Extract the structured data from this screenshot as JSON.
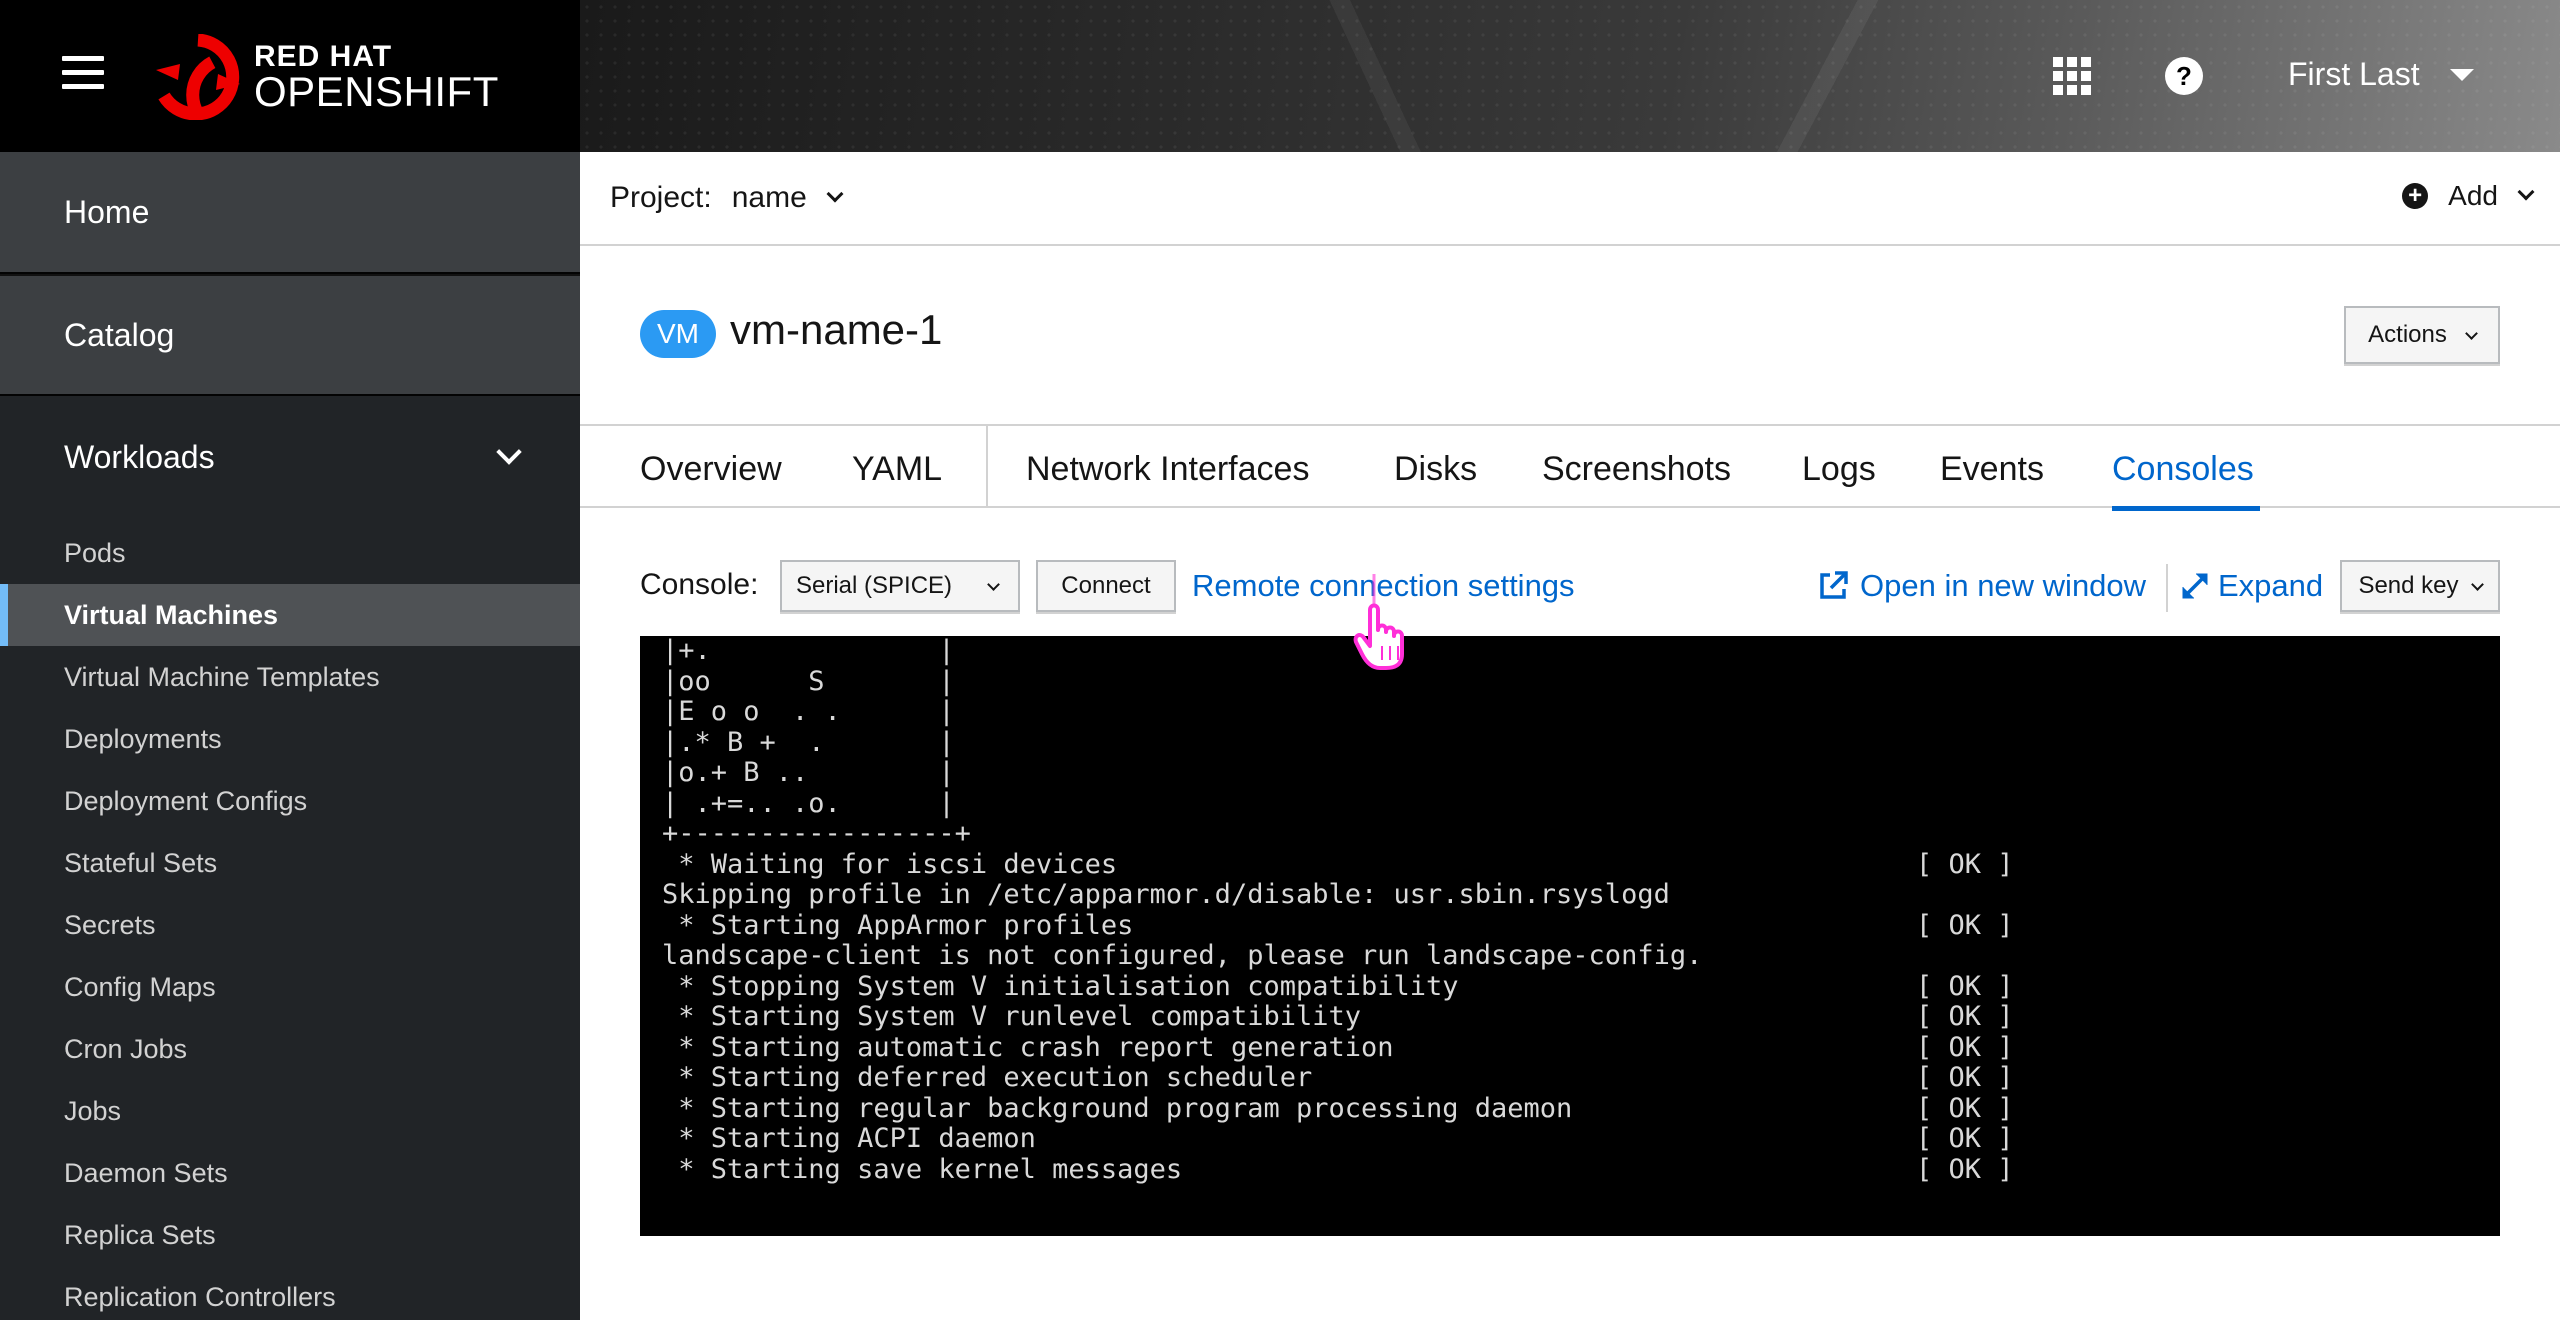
{
  "masthead": {
    "brand_top": "RED HAT",
    "brand_bottom": "OPENSHIFT",
    "user_name": "First Last",
    "icons": [
      "menu-icon",
      "app-launcher-icon",
      "help-icon"
    ]
  },
  "sidebar": {
    "home": "Home",
    "catalog": "Catalog",
    "workloads": "Workloads",
    "items": [
      "Pods",
      "Virtual Machines",
      "Virtual Machine Templates",
      "Deployments",
      "Deployment Configs",
      "Stateful Sets",
      "Secrets",
      "Config Maps",
      "Cron Jobs",
      "Jobs",
      "Daemon Sets",
      "Replica Sets",
      "Replication Controllers"
    ],
    "active_item": "Virtual Machines"
  },
  "project_bar": {
    "label": "Project:",
    "name": "name",
    "add_label": "Add"
  },
  "title": {
    "badge": "VM",
    "name": "vm-name-1",
    "actions_label": "Actions"
  },
  "tabs": {
    "items": [
      "Overview",
      "YAML",
      "Network Interfaces",
      "Disks",
      "Screenshots",
      "Logs",
      "Events",
      "Consoles"
    ],
    "active": "Consoles"
  },
  "console": {
    "label": "Console:",
    "select_value": "Serial (SPICE)",
    "connect_label": "Connect",
    "remote_settings_label": "Remote connection settings",
    "open_new_window_label": "Open in new window",
    "expand_label": "Expand",
    "send_key_label": "Send key"
  },
  "terminal": {
    "lines": [
      "|+.              |",
      "|oo      S       |",
      "|E o o  . .      |",
      "|.* B +  .       |",
      "|o.+ B ..        |",
      "| .+=.. .o.      |",
      "+-----------------+",
      " * Waiting for iscsi devices",
      "Skipping profile in /etc/apparmor.d/disable: usr.sbin.rsyslogd",
      " * Starting AppArmor profiles",
      "landscape-client is not configured, please run landscape-config.",
      " * Stopping System V initialisation compatibility",
      " * Starting System V runlevel compatibility",
      " * Starting automatic crash report generation",
      " * Starting deferred execution scheduler",
      " * Starting regular background program processing daemon",
      " * Starting ACPI daemon",
      " * Starting save kernel messages"
    ],
    "ok_column": [
      "",
      "",
      "",
      "",
      "",
      "",
      "",
      "[ OK ]",
      "",
      "[ OK ]",
      "",
      "[ OK ]",
      "[ OK ]",
      "[ OK ]",
      "[ OK ]",
      "[ OK ]",
      "[ OK ]",
      "[ OK ]"
    ]
  },
  "colors": {
    "accent": "#0066cc",
    "badge": "#2b9af3",
    "sidebar_bg": "#212427",
    "active_marker": "#73bcf7",
    "cursor": "#ff2fd8"
  }
}
